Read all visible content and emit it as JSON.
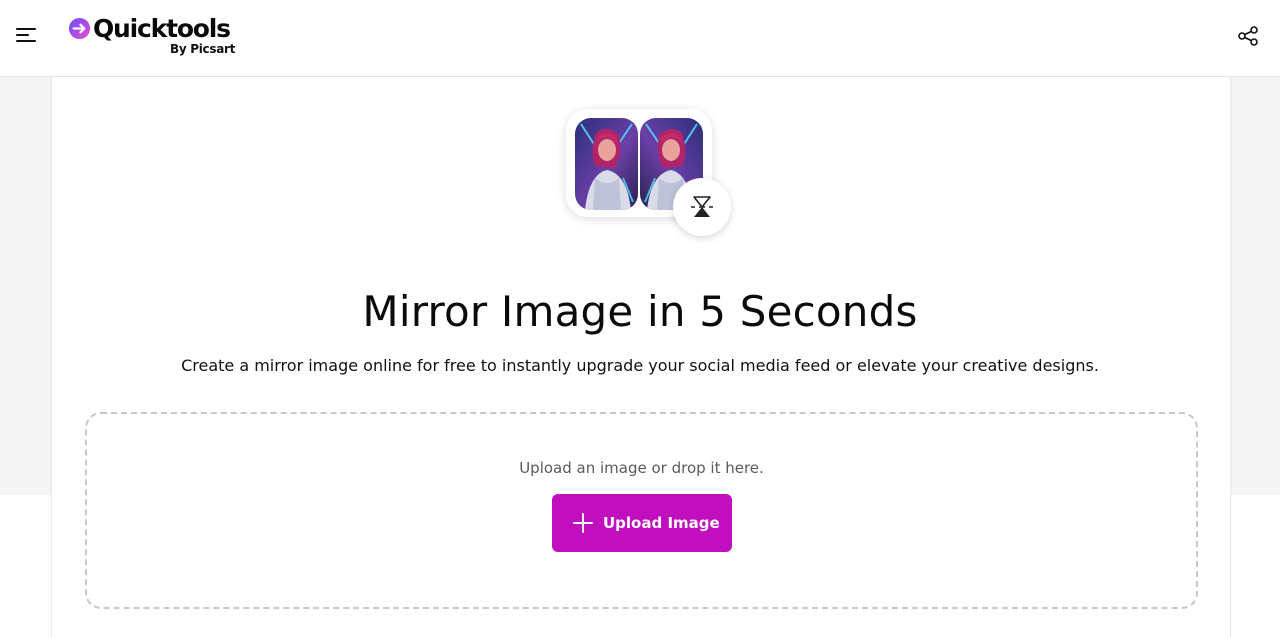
{
  "header": {
    "logo_name": "Quicktools",
    "logo_byline": "By Picsart",
    "menu_icon": "hamburger-menu-icon",
    "share_icon": "share-icon"
  },
  "hero": {
    "image_icon": "mirrored-portrait-image",
    "badge_icon": "mirror-flip-icon"
  },
  "main": {
    "title": "Mirror Image in 5 Seconds",
    "subtitle": "Create a mirror image online for free to instantly upgrade your social media feed or elevate your creative designs."
  },
  "dropzone": {
    "hint": "Upload an image or drop it here.",
    "button_label": "Upload Image",
    "button_icon": "plus-icon"
  },
  "colors": {
    "accent": "#c10fbf",
    "logo_gradient_start": "#6b4cff",
    "logo_gradient_end": "#e54bd0"
  }
}
